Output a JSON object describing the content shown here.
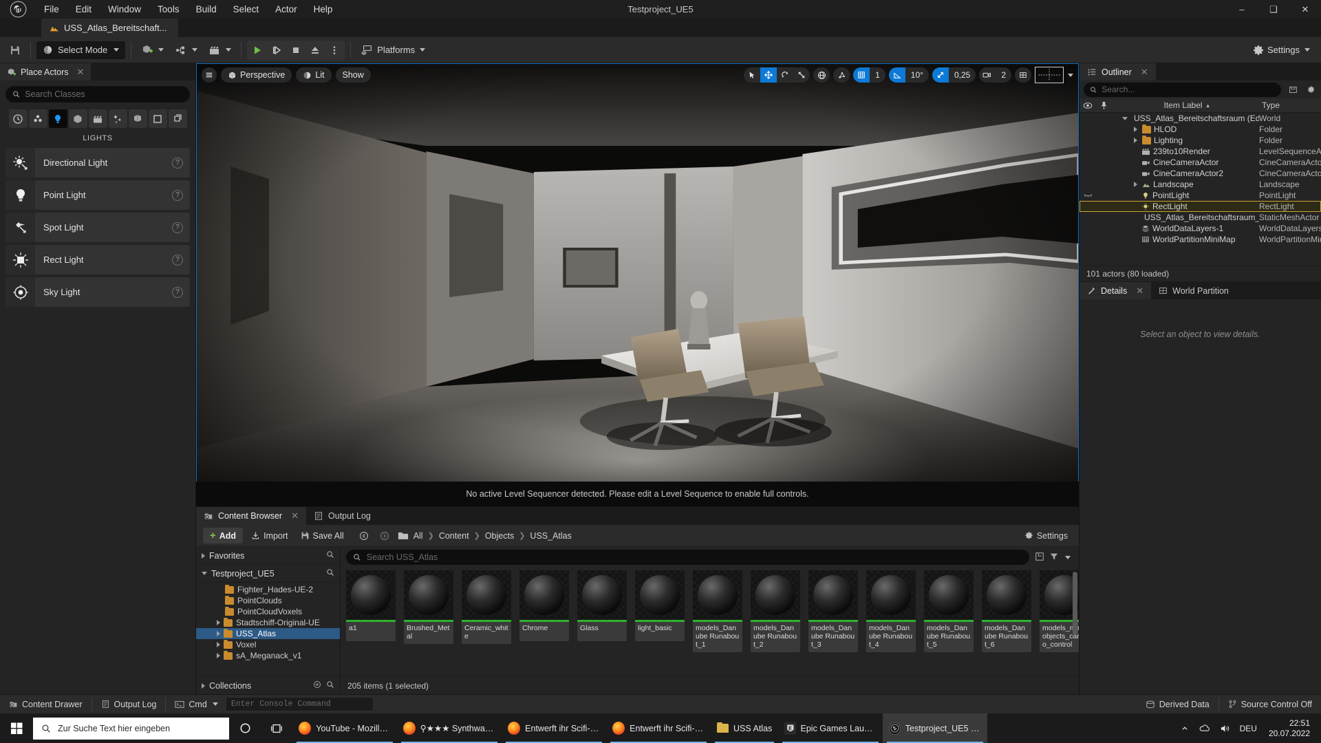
{
  "titlebar": {
    "menus": [
      "File",
      "Edit",
      "Window",
      "Tools",
      "Build",
      "Select",
      "Actor",
      "Help"
    ],
    "project_name": "Testproject_UE5",
    "minimize": "–",
    "maximize": "❑",
    "close": "✕"
  },
  "level_tab": {
    "label": "USS_Atlas_Bereitschaft...",
    "icon": "level-icon"
  },
  "toolbar": {
    "save_tooltip": "Save",
    "mode_label": "Select Mode",
    "platforms_label": "Platforms",
    "settings_label": "Settings"
  },
  "place_actors": {
    "tab_label": "Place Actors",
    "close": "✕",
    "search_placeholder": "Search Classes",
    "categories": [
      "recently-placed-icon",
      "basic-icon",
      "lights-icon",
      "shapes-icon",
      "cinematic-icon",
      "visual-effects-icon",
      "geometry-icon",
      "volumes-icon",
      "all-classes-icon"
    ],
    "active_category_index": 2,
    "section_title": "LIGHTS",
    "items": [
      {
        "label": "Directional Light",
        "icon": "directional-light-icon",
        "help": "?"
      },
      {
        "label": "Point Light",
        "icon": "point-light-icon",
        "help": "?"
      },
      {
        "label": "Spot Light",
        "icon": "spot-light-icon",
        "help": "?"
      },
      {
        "label": "Rect Light",
        "icon": "rect-light-icon",
        "help": "?"
      },
      {
        "label": "Sky Light",
        "icon": "sky-light-icon",
        "help": "?"
      }
    ]
  },
  "viewport": {
    "menu_icon": "hamburger-icon",
    "perspective_label": "Perspective",
    "lit_label": "Lit",
    "show_label": "Show",
    "grid_snap_value": "1",
    "angle_snap_value": "10°",
    "scale_snap_value": "0,25",
    "camera_speed_value": "2",
    "notice": "No active Level Sequencer detected. Please edit a Level Sequence to enable full controls."
  },
  "outliner": {
    "tab_label": "Outliner",
    "close": "✕",
    "search_placeholder": "Search...",
    "columns": {
      "eye": "visibility-column",
      "pin": "pin-column",
      "label": "Item Label",
      "type": "Type"
    },
    "sort_indicator": "▲",
    "rows": [
      {
        "label": "USS_Atlas_Bereitschaftsraum (Editor)",
        "type": "World",
        "indent": 0,
        "icon": "world-icon",
        "twisty": "down",
        "selected": false
      },
      {
        "label": "HLOD",
        "type": "Folder",
        "indent": 1,
        "icon": "folder-icon",
        "twisty": "right",
        "selected": false
      },
      {
        "label": "Lighting",
        "type": "Folder",
        "indent": 1,
        "icon": "folder-icon",
        "twisty": "right",
        "selected": false
      },
      {
        "label": "239to10Render",
        "type": "LevelSequenceActor",
        "indent": 1,
        "icon": "sequence-icon",
        "twisty": "",
        "selected": false
      },
      {
        "label": "CineCameraActor",
        "type": "CineCameraActor",
        "indent": 1,
        "icon": "camera-icon",
        "twisty": "",
        "selected": false
      },
      {
        "label": "CineCameraActor2",
        "type": "CineCameraActor",
        "indent": 1,
        "icon": "camera-icon",
        "twisty": "",
        "selected": false
      },
      {
        "label": "Landscape",
        "type": "Landscape",
        "indent": 1,
        "icon": "landscape-icon",
        "twisty": "right",
        "selected": false
      },
      {
        "label": "PointLight",
        "type": "PointLight",
        "indent": 1,
        "icon": "point-light-small-icon",
        "twisty": "",
        "selected": false,
        "hidden_eye": true
      },
      {
        "label": "RectLight",
        "type": "RectLight",
        "indent": 1,
        "icon": "rect-light-small-icon",
        "twisty": "",
        "selected": true
      },
      {
        "label": "USS_Atlas_Bereitschaftsraum_rpg_r",
        "type": "StaticMeshActor",
        "indent": 1,
        "icon": "mesh-icon",
        "twisty": "",
        "selected": false
      },
      {
        "label": "WorldDataLayers-1",
        "type": "WorldDataLayers",
        "indent": 1,
        "icon": "datalayers-icon",
        "twisty": "",
        "selected": false
      },
      {
        "label": "WorldPartitionMiniMap",
        "type": "WorldPartitionMiniMap",
        "indent": 1,
        "icon": "minimap-icon",
        "twisty": "",
        "selected": false
      }
    ],
    "status": "101 actors (80 loaded)"
  },
  "details": {
    "tabs": [
      {
        "label": "Details",
        "icon": "details-icon",
        "active": true,
        "close": "✕"
      },
      {
        "label": "World Partition",
        "icon": "world-partition-icon",
        "active": false
      }
    ],
    "empty_message": "Select an object to view details."
  },
  "content_browser": {
    "tabs": [
      {
        "label": "Content Browser",
        "icon": "content-browser-icon",
        "active": true,
        "close": "✕"
      },
      {
        "label": "Output Log",
        "icon": "output-log-icon",
        "active": false
      }
    ],
    "add_label": "Add",
    "import_label": "Import",
    "save_all_label": "Save All",
    "breadcrumb": [
      "All",
      "Content",
      "Objects",
      "USS_Atlas"
    ],
    "settings_label": "Settings",
    "tree": {
      "favorites_label": "Favorites",
      "root_label": "Testproject_UE5",
      "items": [
        {
          "label": "Fighter_Hades-UE-2",
          "selected": false,
          "expandable": false
        },
        {
          "label": "PointClouds",
          "selected": false,
          "expandable": false
        },
        {
          "label": "PointCloudVoxels",
          "selected": false,
          "expandable": false
        },
        {
          "label": "Stadtschiff-Original-UE",
          "selected": false,
          "expandable": true
        },
        {
          "label": "USS_Atlas",
          "selected": true,
          "expandable": true
        },
        {
          "label": "Voxel",
          "selected": false,
          "expandable": true
        },
        {
          "label": "sA_Meganack_v1",
          "selected": false,
          "expandable": true
        }
      ],
      "collections_label": "Collections"
    },
    "search_placeholder": "Search USS_Atlas",
    "assets": [
      {
        "name": "a1"
      },
      {
        "name": "Brushed_Metal"
      },
      {
        "name": "Ceramic_white"
      },
      {
        "name": "Chrome"
      },
      {
        "name": "Glass"
      },
      {
        "name": "light_basic"
      },
      {
        "name": "models_Danube Runabout_1"
      },
      {
        "name": "models_Danube Runabout_2"
      },
      {
        "name": "models_Danube Runabout_3"
      },
      {
        "name": "models_Danube Runabout_4"
      },
      {
        "name": "models_Danube Runabout_5"
      },
      {
        "name": "models_Danube Runabout_6"
      },
      {
        "name": "models_mapobjects_cargo_control"
      }
    ],
    "status": "205 items (1 selected)"
  },
  "status_bar": {
    "content_drawer": "Content Drawer",
    "output_log": "Output Log",
    "cmd_label": "Cmd",
    "console_placeholder": "Enter Console Command",
    "derived_data": "Derived Data",
    "source_control": "Source Control Off"
  },
  "taskbar": {
    "search_placeholder": "Zur Suche Text hier eingeben",
    "items": [
      {
        "label": "YouTube - Mozilla ...",
        "icon": "firefox-icon",
        "active": false,
        "underline": true
      },
      {
        "label": "⚲★★★ Synthwave...",
        "icon": "firefox-icon",
        "active": false,
        "underline": true
      },
      {
        "label": "Entwerft ihr Scifi-R...",
        "icon": "firefox-icon",
        "active": false,
        "underline": true
      },
      {
        "label": "Entwerft ihr Scifi-R...",
        "icon": "firefox-icon",
        "active": false,
        "underline": true
      },
      {
        "label": "USS Atlas",
        "icon": "folder-icon",
        "active": false,
        "underline": true
      },
      {
        "label": "Epic Games Launch...",
        "icon": "epic-icon",
        "active": false,
        "underline": true
      },
      {
        "label": "Testproject_UE5 - U...",
        "icon": "unreal-icon",
        "active": true,
        "underline": true
      }
    ],
    "language": "DEU",
    "time": "22:51",
    "date": "20.07.2022"
  },
  "colors": {
    "accent_blue": "#0c7ad6",
    "selection_yellow": "#c8a62e",
    "asset_bar_green": "#2fb22f",
    "panel_bg": "#242424",
    "toolbar_bg": "#2b2b2b"
  }
}
